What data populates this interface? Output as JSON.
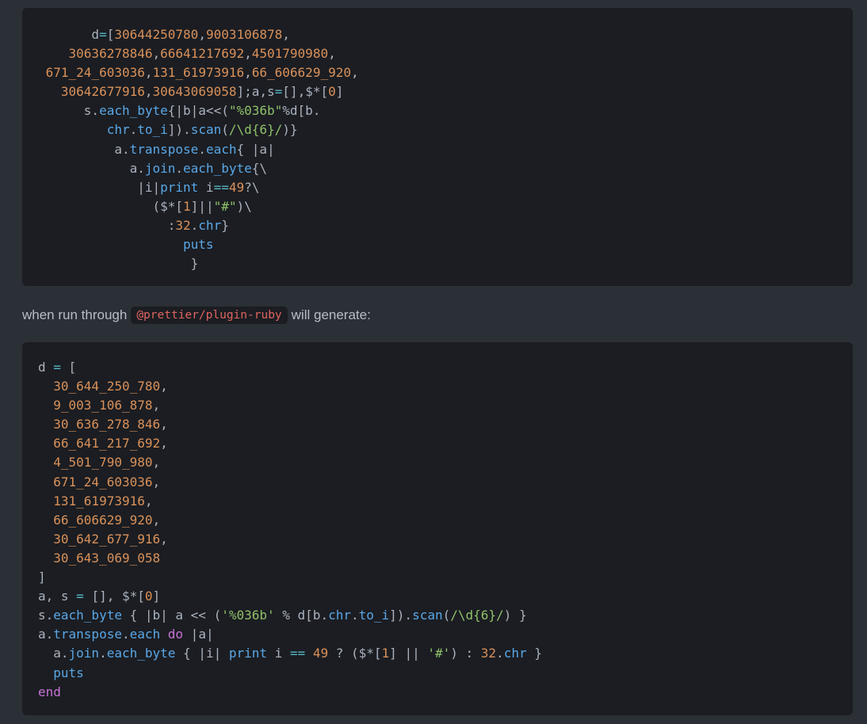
{
  "prose": {
    "before": "when run through",
    "package": "@prettier/plugin-ruby",
    "after": "will generate:"
  },
  "colors": {
    "page_background": "#2b2f36",
    "code_background": "#1b1d22",
    "default_text": "#abb2bf",
    "number": "#d9915a",
    "string": "#8fc06a",
    "method": "#5aa7e6",
    "keyword": "#c772d6",
    "operator": "#56b6c2",
    "inline_code": "#e0645f"
  },
  "code_blocks": [
    {
      "lines": [
        [
          [
            "",
            "       d"
          ],
          [
            "op",
            "="
          ],
          [
            "",
            "["
          ],
          [
            "num",
            "30644250780"
          ],
          [
            "",
            ","
          ],
          [
            "num",
            "9003106878"
          ],
          [
            "",
            ","
          ]
        ],
        [
          [
            "",
            "    "
          ],
          [
            "num",
            "30636278846"
          ],
          [
            "",
            ","
          ],
          [
            "num",
            "66641217692"
          ],
          [
            "",
            ","
          ],
          [
            "num",
            "4501790980"
          ],
          [
            "",
            ","
          ]
        ],
        [
          [
            "",
            " "
          ],
          [
            "num",
            "671_24_603036"
          ],
          [
            "",
            ","
          ],
          [
            "num",
            "131_61973916"
          ],
          [
            "",
            ","
          ],
          [
            "num",
            "66_606629_920"
          ],
          [
            "",
            ","
          ]
        ],
        [
          [
            "",
            "   "
          ],
          [
            "num",
            "30642677916"
          ],
          [
            "",
            ","
          ],
          [
            "num",
            "30643069058"
          ],
          [
            "",
            "];a,s"
          ],
          [
            "op",
            "="
          ],
          [
            "",
            "[],$*["
          ],
          [
            "num",
            "0"
          ],
          [
            "",
            "]"
          ]
        ],
        [
          [
            "",
            "      s."
          ],
          [
            "fn",
            "each_byte"
          ],
          [
            "",
            "{|b|a<<("
          ],
          [
            "str",
            "\"%036b\""
          ],
          [
            "",
            "%d[b."
          ]
        ],
        [
          [
            "",
            "         "
          ],
          [
            "fn",
            "chr"
          ],
          [
            "",
            "."
          ],
          [
            "fn",
            "to_i"
          ],
          [
            "",
            "])."
          ],
          [
            "fn",
            "scan"
          ],
          [
            "",
            "("
          ],
          [
            "str",
            "/\\d{6}/"
          ],
          [
            "",
            ")}"
          ]
        ],
        [
          [
            "",
            "          a."
          ],
          [
            "fn",
            "transpose"
          ],
          [
            "",
            "."
          ],
          [
            "fn",
            "each"
          ],
          [
            "",
            "{ |a|"
          ]
        ],
        [
          [
            "",
            "            a."
          ],
          [
            "fn",
            "join"
          ],
          [
            "",
            "."
          ],
          [
            "fn",
            "each_byte"
          ],
          [
            "",
            "{\\"
          ]
        ],
        [
          [
            "",
            "             |i|"
          ],
          [
            "fn",
            "print"
          ],
          [
            "",
            " i"
          ],
          [
            "op",
            "=="
          ],
          [
            "num",
            "49"
          ],
          [
            "",
            "?\\"
          ]
        ],
        [
          [
            "",
            "               ($*["
          ],
          [
            "num",
            "1"
          ],
          [
            "",
            "]||"
          ],
          [
            "str",
            "\"#\""
          ],
          [
            "",
            ")\\"
          ]
        ],
        [
          [
            "",
            "                 :"
          ],
          [
            "num",
            "32"
          ],
          [
            "",
            "."
          ],
          [
            "fn",
            "chr"
          ],
          [
            "",
            "}"
          ]
        ],
        [
          [
            "",
            "                   "
          ],
          [
            "fn",
            "puts"
          ]
        ],
        [
          [
            "",
            "                    }"
          ]
        ]
      ]
    },
    {
      "lines": [
        [
          [
            "",
            "d "
          ],
          [
            "op",
            "="
          ],
          [
            "",
            " ["
          ]
        ],
        [
          [
            "",
            "  "
          ],
          [
            "num",
            "30_644_250_780"
          ],
          [
            "",
            ","
          ]
        ],
        [
          [
            "",
            "  "
          ],
          [
            "num",
            "9_003_106_878"
          ],
          [
            "",
            ","
          ]
        ],
        [
          [
            "",
            "  "
          ],
          [
            "num",
            "30_636_278_846"
          ],
          [
            "",
            ","
          ]
        ],
        [
          [
            "",
            "  "
          ],
          [
            "num",
            "66_641_217_692"
          ],
          [
            "",
            ","
          ]
        ],
        [
          [
            "",
            "  "
          ],
          [
            "num",
            "4_501_790_980"
          ],
          [
            "",
            ","
          ]
        ],
        [
          [
            "",
            "  "
          ],
          [
            "num",
            "671_24_603036"
          ],
          [
            "",
            ","
          ]
        ],
        [
          [
            "",
            "  "
          ],
          [
            "num",
            "131_61973916"
          ],
          [
            "",
            ","
          ]
        ],
        [
          [
            "",
            "  "
          ],
          [
            "num",
            "66_606629_920"
          ],
          [
            "",
            ","
          ]
        ],
        [
          [
            "",
            "  "
          ],
          [
            "num",
            "30_642_677_916"
          ],
          [
            "",
            ","
          ]
        ],
        [
          [
            "",
            "  "
          ],
          [
            "num",
            "30_643_069_058"
          ]
        ],
        [
          [
            "",
            "]"
          ]
        ],
        [
          [
            "",
            "a, s "
          ],
          [
            "op",
            "="
          ],
          [
            "",
            " [], $*["
          ],
          [
            "num",
            "0"
          ],
          [
            "",
            "]"
          ]
        ],
        [
          [
            "",
            "s."
          ],
          [
            "fn",
            "each_byte"
          ],
          [
            "",
            " { |b| a << ("
          ],
          [
            "str",
            "'%036b'"
          ],
          [
            "",
            " % d[b."
          ],
          [
            "fn",
            "chr"
          ],
          [
            "",
            "."
          ],
          [
            "fn",
            "to_i"
          ],
          [
            "",
            "])."
          ],
          [
            "fn",
            "scan"
          ],
          [
            "",
            "("
          ],
          [
            "str",
            "/\\d{6}/"
          ],
          [
            "",
            ") }"
          ]
        ],
        [
          [
            "",
            "a."
          ],
          [
            "fn",
            "transpose"
          ],
          [
            "",
            "."
          ],
          [
            "fn",
            "each"
          ],
          [
            "",
            " "
          ],
          [
            "kw",
            "do"
          ],
          [
            "",
            " |a|"
          ]
        ],
        [
          [
            "",
            "  a."
          ],
          [
            "fn",
            "join"
          ],
          [
            "",
            "."
          ],
          [
            "fn",
            "each_byte"
          ],
          [
            "",
            " { |i| "
          ],
          [
            "fn",
            "print"
          ],
          [
            "",
            " i "
          ],
          [
            "op",
            "=="
          ],
          [
            "",
            " "
          ],
          [
            "num",
            "49"
          ],
          [
            "",
            " ? ($*["
          ],
          [
            "num",
            "1"
          ],
          [
            "",
            "] || "
          ],
          [
            "str",
            "'#'"
          ],
          [
            "",
            ") : "
          ],
          [
            "num",
            "32"
          ],
          [
            "",
            "."
          ],
          [
            "fn",
            "chr"
          ],
          [
            "",
            " }"
          ]
        ],
        [
          [
            "",
            "  "
          ],
          [
            "fn",
            "puts"
          ]
        ],
        [
          [
            "kw",
            "end"
          ]
        ]
      ]
    }
  ]
}
